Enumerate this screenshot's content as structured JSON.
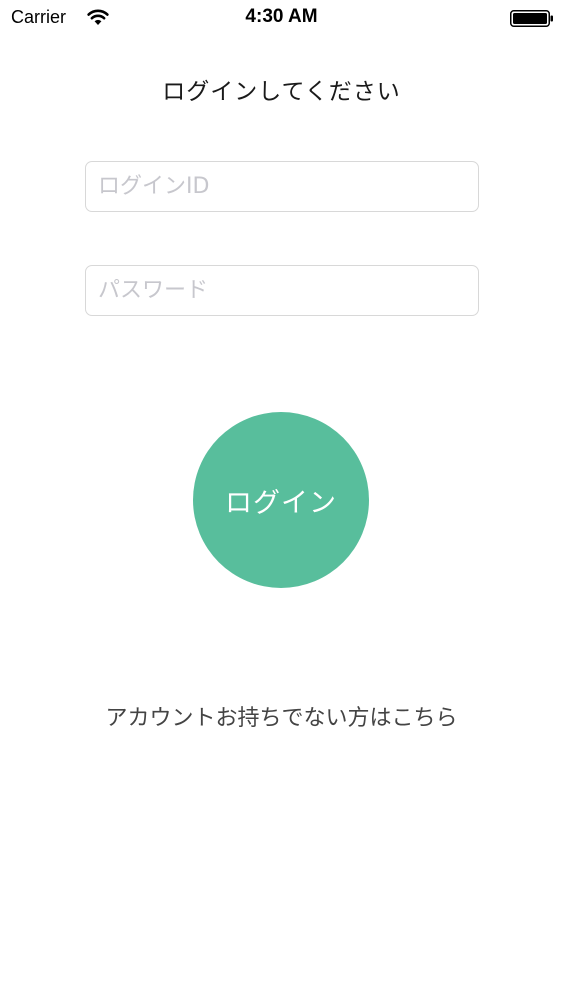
{
  "status_bar": {
    "carrier": "Carrier",
    "time": "4:30 AM",
    "wifi_icon": "wifi-icon",
    "battery_icon": "battery-icon"
  },
  "screen": {
    "title": "ログインしてください"
  },
  "form": {
    "login_id_placeholder": "ログインID",
    "login_id_value": "",
    "password_placeholder": "パスワード",
    "password_value": ""
  },
  "actions": {
    "login_label": "ログイン",
    "signup_link": "アカウントお持ちでない方はこちら"
  },
  "colors": {
    "accent": "#58be9c",
    "background": "#ffffff",
    "placeholder": "#c7c7cd",
    "field_border": "#d8d8d8"
  }
}
